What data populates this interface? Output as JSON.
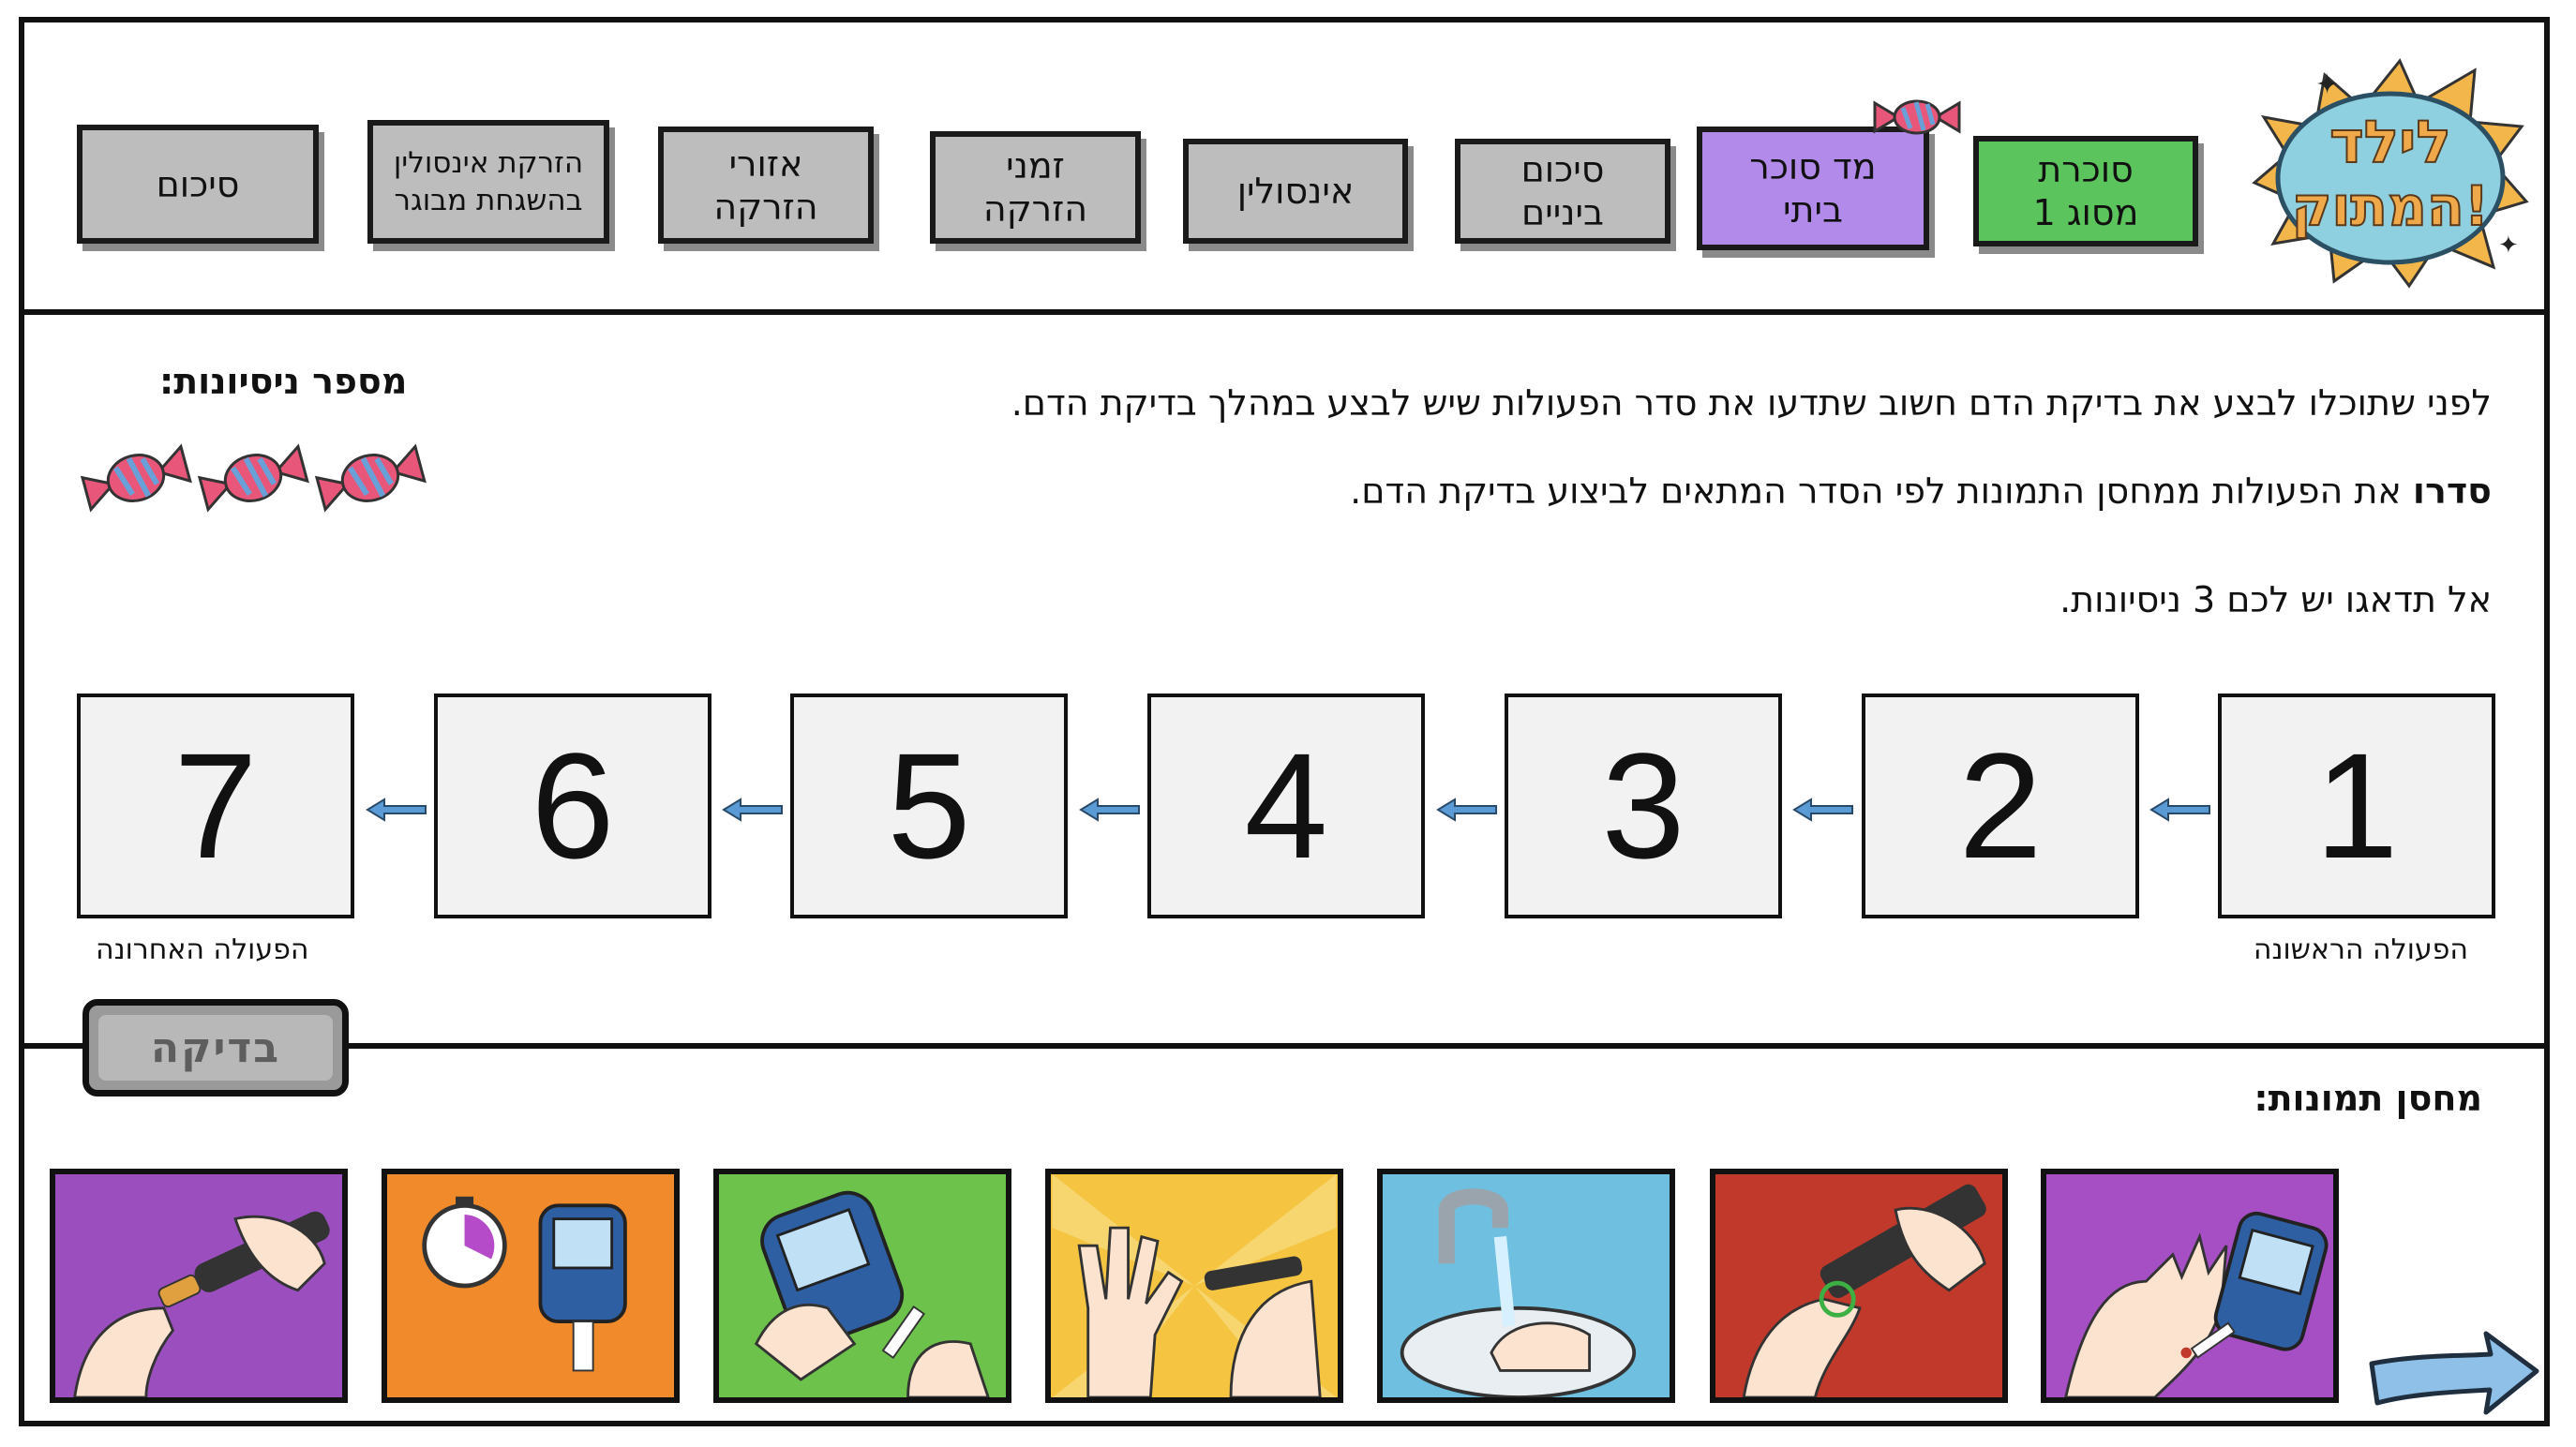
{
  "nav": [
    {
      "label": "סוכרת\nמסוג 1",
      "color": "#5cc45c"
    },
    {
      "label": "מד סוכר\nביתי",
      "color": "#b28bea",
      "active": true
    },
    {
      "label": "סיכום\nביניים"
    },
    {
      "label": "אינסולין"
    },
    {
      "label": "זמני\nהזרקה"
    },
    {
      "label": "אזורי\nהזרקה"
    },
    {
      "label": "הזרקת אינסולין\nבהשגחת מבוגר"
    },
    {
      "label": "סיכום"
    }
  ],
  "logo": {
    "text_line1": "לילד",
    "text_line2": "המתוק!"
  },
  "instructions": {
    "line1": "לפני שתוכלו לבצע את בדיקת הדם חשוב שתדעו את סדר הפעולות שיש לבצע במהלך בדיקת הדם.",
    "line2_bold": "סדרו",
    "line2_rest": " את הפעולות ממחסן התמונות לפי הסדר המתאים לביצוע בדיקת הדם.",
    "line3": "אל תדאגו יש לכם 3 ניסיונות."
  },
  "attempts": {
    "label": "מספר ניסיונות:",
    "remaining": 3
  },
  "sequence": {
    "slots": [
      "1",
      "2",
      "3",
      "4",
      "5",
      "6",
      "7"
    ],
    "first_caption": "הפעולה הראשונה",
    "last_caption": "הפעולה האחרונה"
  },
  "check_button": {
    "label": "בדיקה"
  },
  "gallery": {
    "label": "מחסן תמונות:",
    "tiles": [
      {
        "icon": "lancet-cap-icon",
        "bg": "#9b4fbf"
      },
      {
        "icon": "timer-glucometer-icon",
        "bg": "#f08a2a"
      },
      {
        "icon": "insert-strip-icon",
        "bg": "#6cc24a"
      },
      {
        "icon": "hands-lancet-icon",
        "bg": "#f5c542"
      },
      {
        "icon": "wash-hands-icon",
        "bg": "#6fc0e0"
      },
      {
        "icon": "lancet-depth-icon",
        "bg": "#c0392b"
      },
      {
        "icon": "blood-sample-icon",
        "bg": "#a64fc4"
      }
    ]
  },
  "colors": {
    "slot_bg": "#f2f2f2",
    "nav_bg": "#bdbdbd",
    "arrow": "#5b9bd5"
  }
}
